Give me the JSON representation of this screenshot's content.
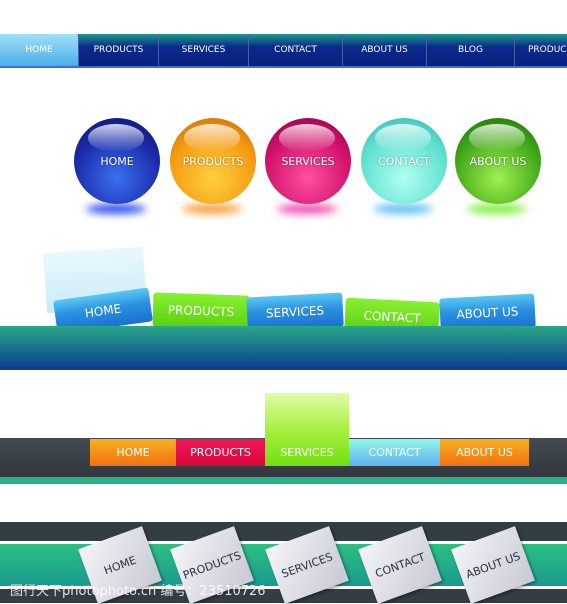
{
  "nav_bar_1": {
    "items": [
      "HOME",
      "PRODUCTS",
      "SERVICES",
      "CONTACT",
      "ABOUT US",
      "BLOG",
      "PRODUC"
    ],
    "active": "HOME"
  },
  "orb_menu": {
    "items": [
      {
        "label": "HOME",
        "color": "#1a2aa8"
      },
      {
        "label": "PRODUCTS",
        "color": "#f59a10"
      },
      {
        "label": "SERVICES",
        "color": "#d0106a"
      },
      {
        "label": "CONTACT",
        "color": "#60e0d0"
      },
      {
        "label": "ABOUT US",
        "color": "#40a818"
      }
    ]
  },
  "tab_menu": {
    "items": [
      "HOME",
      "PRODUCTS",
      "SERVICES",
      "CONTACT",
      "ABOUT US"
    ]
  },
  "flat_menu": {
    "items": [
      {
        "label": "HOME",
        "color": "#f08010"
      },
      {
        "label": "PRODUCTS",
        "color": "#e01048"
      },
      {
        "label": "SERVICES",
        "color": "#80e020"
      },
      {
        "label": "CONTACT",
        "color": "#70c8f0"
      },
      {
        "label": "ABOUT US",
        "color": "#f07a10"
      }
    ],
    "active": "SERVICES"
  },
  "paper_menu": {
    "items": [
      "HOME",
      "PRODUCTS",
      "SERVICES",
      "CONTACT",
      "ABOUT US"
    ]
  },
  "watermark": "图行天下photophoto.cn  编号：23510726"
}
